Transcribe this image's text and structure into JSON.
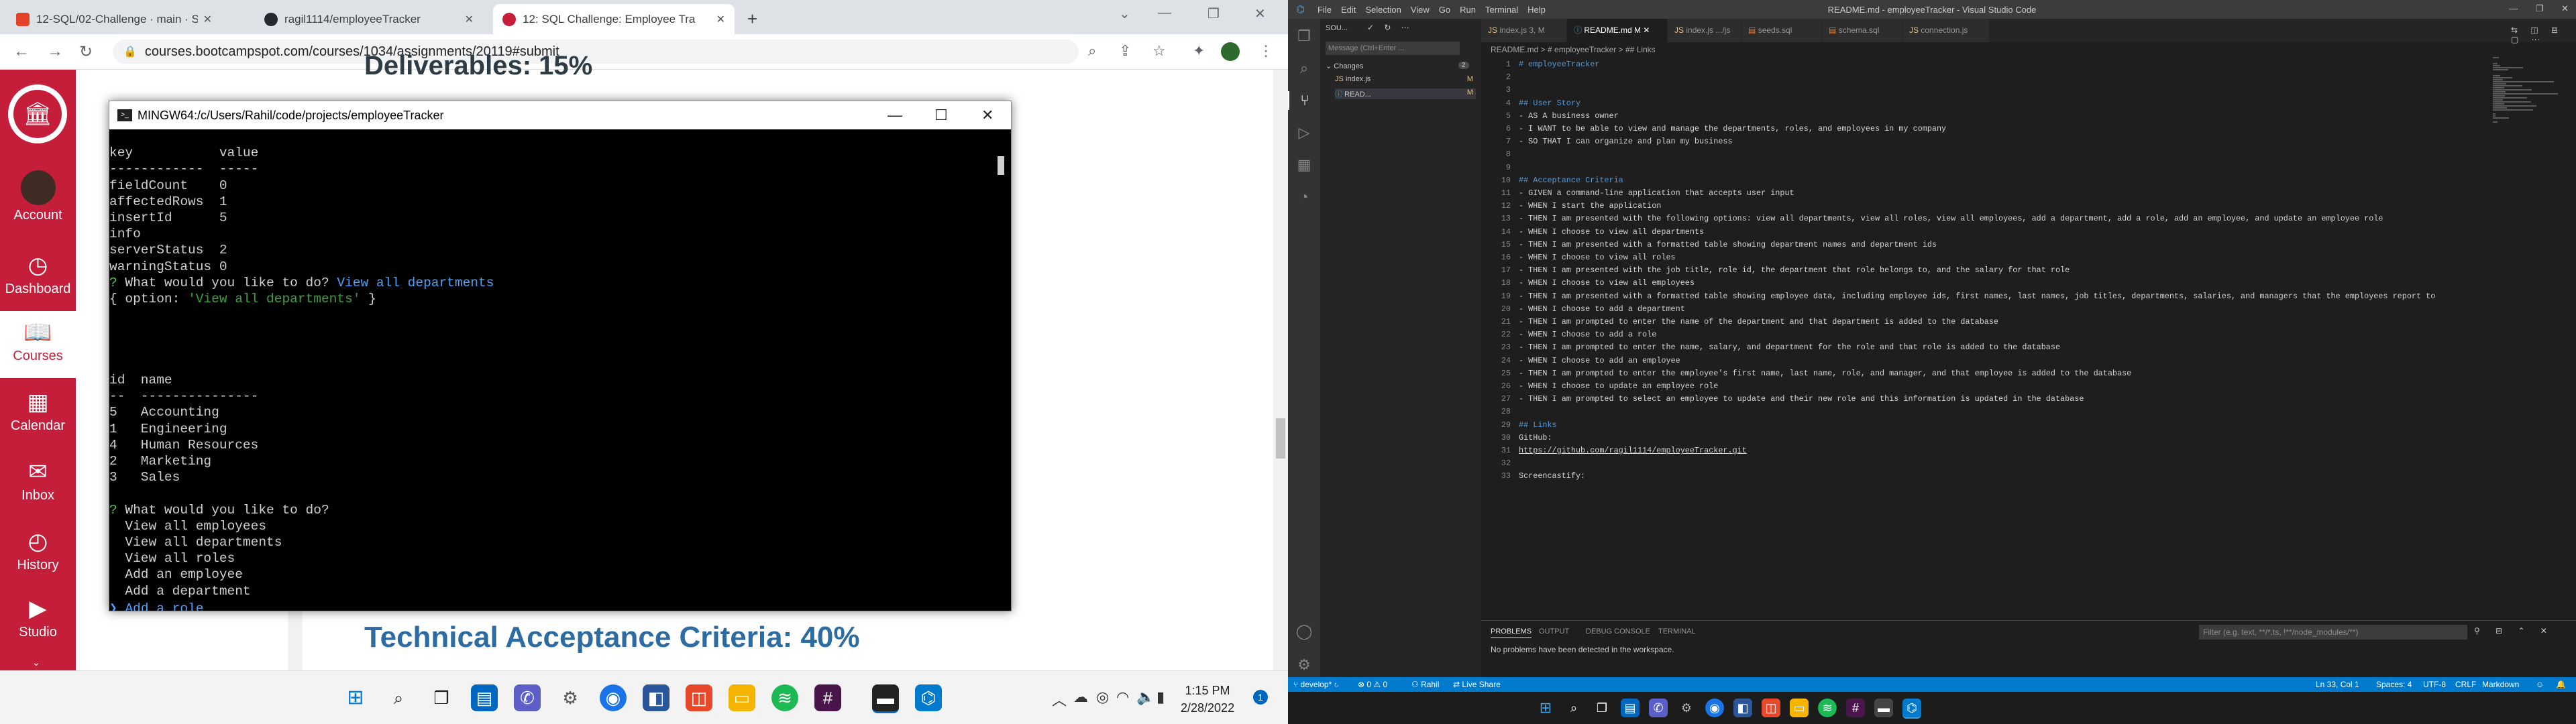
{
  "left": {
    "chrome": {
      "tabs": [
        {
          "label": "12-SQL/02-Challenge · main · SM",
          "color": "#e24329"
        },
        {
          "label": "ragil1114/employeeTracker",
          "color": "#24292f"
        },
        {
          "label": "12: SQL Challenge: Employee Tra",
          "color": "#c41e3a"
        }
      ],
      "new_tab": "+",
      "url": "courses.bootcampspot.com/courses/1034/assignments/20119#submit"
    },
    "canvas_nav": [
      {
        "label": "Account",
        "icon": "avatar"
      },
      {
        "label": "Dashboard",
        "icon": "dashboard-icon"
      },
      {
        "label": "Courses",
        "icon": "book-icon"
      },
      {
        "label": "Calendar",
        "icon": "calendar-icon"
      },
      {
        "label": "Inbox",
        "icon": "inbox-icon"
      },
      {
        "label": "History",
        "icon": "history-icon"
      },
      {
        "label": "Studio",
        "icon": "studio-icon"
      }
    ],
    "page": {
      "deliverables_heading": "Deliverables: 15%",
      "tech_heading": "Technical Acceptance Criteria: 40%"
    },
    "terminal": {
      "title": "MINGW64:/c/Users/Rahil/code/projects/employeeTracker",
      "lines": [
        {
          "text": "",
          "style": ""
        },
        {
          "text": "key           value",
          "style": ""
        },
        {
          "text": "------------  -----",
          "style": ""
        },
        {
          "text": "fieldCount    0",
          "style": ""
        },
        {
          "text": "affectedRows  1",
          "style": ""
        },
        {
          "text": "insertId      5",
          "style": ""
        },
        {
          "text": "info",
          "style": ""
        },
        {
          "text": "serverStatus  2",
          "style": ""
        },
        {
          "text": "warningStatus 0",
          "style": ""
        },
        {
          "text": "",
          "style": ""
        },
        {
          "text": "",
          "style": ""
        },
        {
          "text": "",
          "style": ""
        },
        {
          "text": "",
          "style": ""
        },
        {
          "text": "",
          "style": ""
        },
        {
          "text": "",
          "style": ""
        },
        {
          "text": "id  name",
          "style": ""
        },
        {
          "text": "--  ---------------",
          "style": ""
        },
        {
          "text": "5   Accounting",
          "style": ""
        },
        {
          "text": "1   Engineering",
          "style": ""
        },
        {
          "text": "4   Human Resources",
          "style": ""
        },
        {
          "text": "2   Marketing",
          "style": ""
        },
        {
          "text": "3   Sales",
          "style": ""
        },
        {
          "text": "",
          "style": ""
        },
        {
          "text": "",
          "style": ""
        },
        {
          "text": "  View all employees",
          "style": ""
        },
        {
          "text": "  View all departments",
          "style": ""
        },
        {
          "text": "  View all roles",
          "style": ""
        },
        {
          "text": "  Add an employee",
          "style": ""
        },
        {
          "text": "  Add a department",
          "style": ""
        }
      ],
      "prompt_q": "What would you like to do?",
      "prompt_ans": "View all departments",
      "option_line_pre": "{ option: ",
      "option_line_str": "'View all departments'",
      "option_line_post": " }",
      "selected_option": "Add a role"
    },
    "taskbar": {
      "time": "1:15 PM",
      "date": "2/28/2022",
      "notification_count": "1"
    }
  },
  "right": {
    "title": "README.md - employeeTracker - Visual Studio Code",
    "menu": [
      "File",
      "Edit",
      "Selection",
      "View",
      "Go",
      "Run",
      "Terminal",
      "Help"
    ],
    "sidebar": {
      "header": "SOU...",
      "message_placeholder": "Message (Ctrl+Enter ...",
      "changes_label": "Changes",
      "changes_count": "2",
      "files": [
        {
          "name": "index.js",
          "status": "M"
        },
        {
          "name": "READ...",
          "status": "M"
        }
      ]
    },
    "tabs": [
      {
        "label": "index.js  3, M",
        "color": "#e2c08d"
      },
      {
        "label": "README.md  M",
        "color": "#519aba"
      },
      {
        "label": "index.js  .../js",
        "color": "#e2c08d"
      },
      {
        "label": "seeds.sql",
        "color": "#e37933"
      },
      {
        "label": "schema.sql",
        "color": "#e37933"
      },
      {
        "label": "connection.js",
        "color": "#e2c08d"
      }
    ],
    "breadcrumb": "README.md > # employeeTracker > ## Links",
    "editor_lines": [
      "# employeeTracker",
      "",
      "",
      "## User Story",
      "- AS A business owner",
      "- I WANT to be able to view and manage the departments, roles, and employees in my company",
      "- SO THAT I can organize and plan my business",
      "",
      "",
      "## Acceptance Criteria",
      "- GIVEN a command-line application that accepts user input",
      "- WHEN I start the application",
      "- THEN I am presented with the following options: view all departments, view all roles, view all employees, add a department, add a role, add an employee, and update an employee role",
      "- WHEN I choose to view all departments",
      "- THEN I am presented with a formatted table showing department names and department ids",
      "- WHEN I choose to view all roles",
      "- THEN I am presented with the job title, role id, the department that role belongs to, and the salary for that role",
      "- WHEN I choose to view all employees",
      "- THEN I am presented with a formatted table showing employee data, including employee ids, first names, last names, job titles, departments, salaries, and managers that the employees report to",
      "- WHEN I choose to add a department",
      "- THEN I am prompted to enter the name of the department and that department is added to the database",
      "- WHEN I choose to add a role",
      "- THEN I am prompted to enter the name, salary, and department for the role and that role is added to the database",
      "- WHEN I choose to add an employee",
      "- THEN I am prompted to enter the employee's first name, last name, role, and manager, and that employee is added to the database",
      "- WHEN I choose to update an employee role",
      "- THEN I am prompted to select an employee to update and their new role and this information is updated in the database",
      "",
      "## Links",
      "GitHub:",
      "https://github.com/ragil1114/employeeTracker.git",
      "",
      "Screencastify:"
    ],
    "panel": {
      "tabs": [
        "PROBLEMS",
        "OUTPUT",
        "DEBUG CONSOLE",
        "TERMINAL"
      ],
      "message": "No problems have been detected in the workspace.",
      "filter_placeholder": "Filter (e.g. text, **/*.ts, !**/node_modules/**)"
    },
    "status": {
      "branch": "develop*",
      "problems": "⊗ 0 ⚠ 0",
      "user": "Rahil",
      "live_share": "Live Share",
      "position": "Ln 33, Col 1",
      "spaces": "Spaces: 4",
      "encoding": "UTF-8",
      "eol": "CRLF",
      "language": "Markdown"
    }
  }
}
